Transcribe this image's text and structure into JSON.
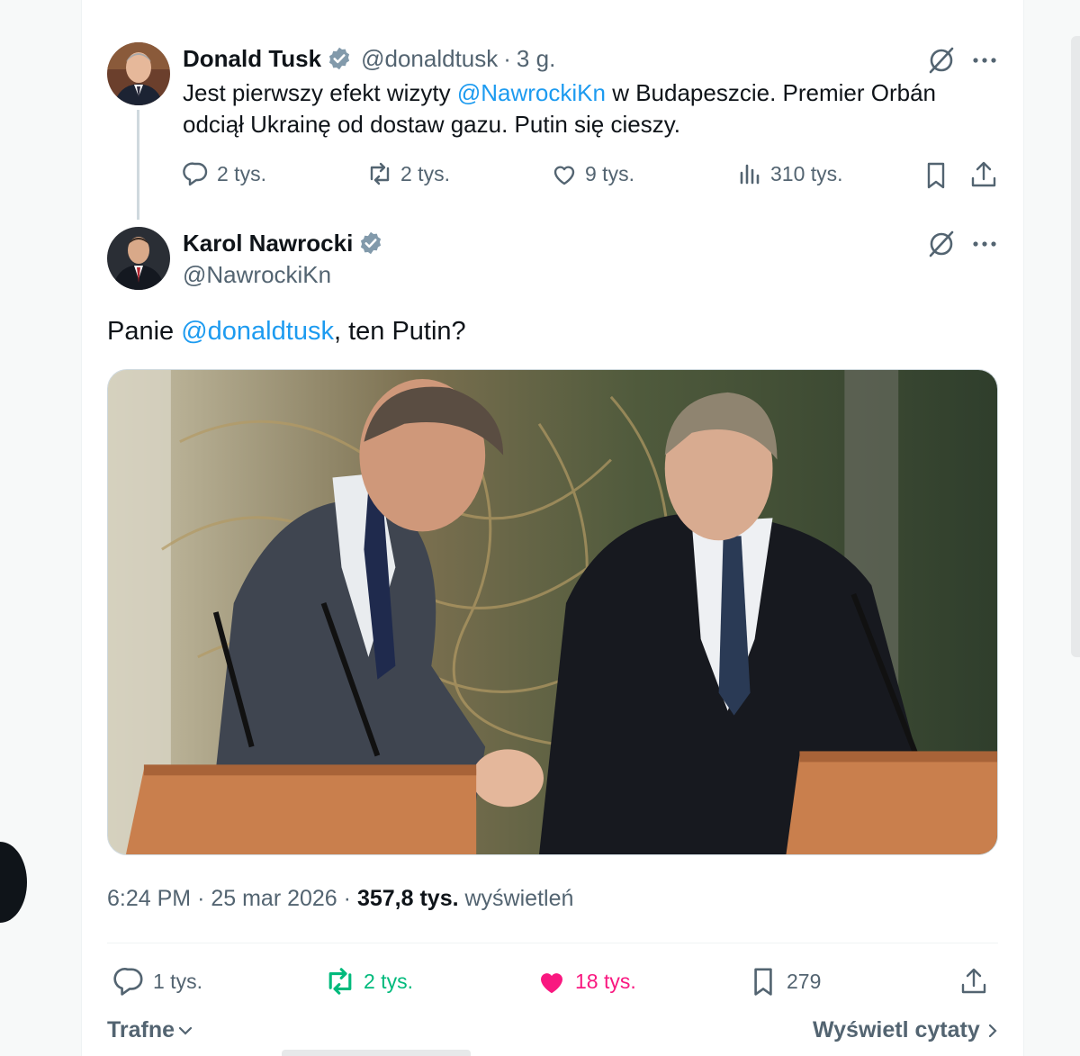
{
  "colors": {
    "accent": "#1d9bf0",
    "like": "#f91880",
    "retweet": "#00ba7c",
    "muted": "#536471",
    "text": "#0f1419"
  },
  "tweet1": {
    "name": "Donald Tusk",
    "handle": "@donaldtusk",
    "separator": "·",
    "time": "3 g.",
    "text_before": "Jest pierwszy efekt wizyty ",
    "mention": "@NawrockiKn",
    "text_after": " w Budapeszcie. Premier Orbán odciął Ukrainę od dostaw gazu. Putin się cieszy.",
    "replies": "2 tys.",
    "retweets": "2 tys.",
    "likes": "9 tys.",
    "views": "310 tys.",
    "icons": [
      "verified-badge-icon",
      "grok-icon",
      "more-icon",
      "reply-icon",
      "retweet-icon",
      "like-icon",
      "views-icon",
      "bookmark-icon",
      "share-icon"
    ]
  },
  "tweet2": {
    "name": "Karol Nawrocki",
    "handle": "@NawrockiKn",
    "text_before": "Panie ",
    "mention": "@donaldtusk",
    "text_after": ", ten Putin?",
    "time": "6:24 PM",
    "separator1": "·",
    "date": "25 mar 2026",
    "separator2": "·",
    "views_count": "357,8 tys.",
    "views_label": "wyświetleń",
    "replies": "1 tys.",
    "retweets": "2 tys.",
    "likes": "18 tys.",
    "bookmarks": "279",
    "liked": true,
    "retweeted": true
  },
  "footer": {
    "sort_label": "Trafne",
    "quotes_label": "Wyświetl cytaty"
  }
}
